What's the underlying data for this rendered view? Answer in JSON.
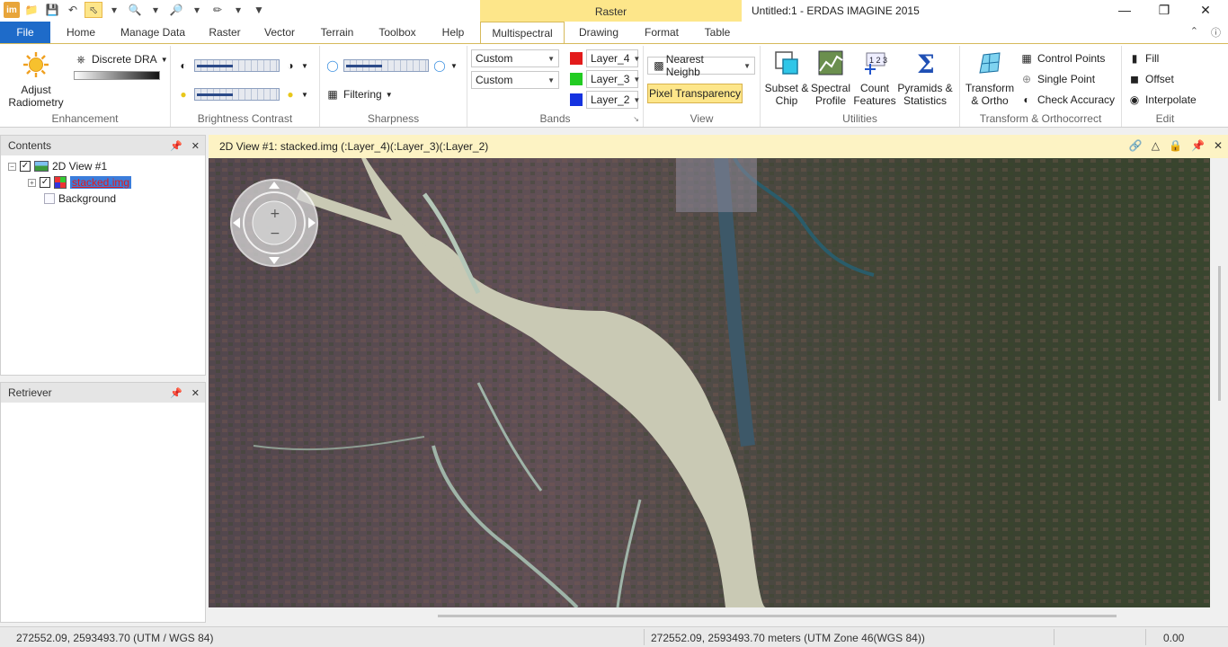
{
  "app": {
    "window_title": "Untitled:1 - ERDAS IMAGINE 2015",
    "context_tab_group": "Raster"
  },
  "tabs": {
    "file": "File",
    "home": "Home",
    "manage_data": "Manage Data",
    "raster": "Raster",
    "vector": "Vector",
    "terrain": "Terrain",
    "toolbox": "Toolbox",
    "help": "Help",
    "multispectral": "Multispectral",
    "drawing": "Drawing",
    "format": "Format",
    "table": "Table"
  },
  "ribbon": {
    "enhancement": {
      "adjust_radiometry": "Adjust Radiometry",
      "discrete_dra": "Discrete DRA",
      "label": "Enhancement"
    },
    "brightness_contrast": {
      "label": "Brightness Contrast"
    },
    "sharpness": {
      "filtering": "Filtering",
      "label": "Sharpness"
    },
    "bands": {
      "combo_top": "Custom",
      "combo_bottom": "Custom",
      "red_layer": "Layer_4",
      "green_layer": "Layer_3",
      "blue_layer": "Layer_2",
      "red_color": "#e31b1b",
      "green_color": "#22cc22",
      "blue_color": "#1533e0",
      "label": "Bands"
    },
    "view": {
      "resample": "Nearest Neighb",
      "pixel_transparency": "Pixel Transparency",
      "label": "View"
    },
    "utilities": {
      "subset_chip": "Subset & Chip",
      "spectral_profile": "Spectral Profile",
      "count_features": "Count Features",
      "pyramids_statistics": "Pyramids & Statistics",
      "label": "Utilities"
    },
    "transform": {
      "transform_ortho": "Transform & Ortho",
      "control_points": "Control Points",
      "single_point": "Single Point",
      "check_accuracy": "Check Accuracy",
      "label": "Transform & Orthocorrect"
    },
    "edit": {
      "fill": "Fill",
      "offset": "Offset",
      "interpolate": "Interpolate",
      "label": "Edit"
    }
  },
  "contents_panel": {
    "title": "Contents",
    "view_node": "2D View #1",
    "layer_node": "stacked.img",
    "background_node": "Background"
  },
  "retriever_panel": {
    "title": "Retriever"
  },
  "viewer": {
    "title": "2D View #1: stacked.img (:Layer_4)(:Layer_3)(:Layer_2)"
  },
  "status_bar": {
    "coords_left": "272552.09, 2593493.70  (UTM / WGS 84)",
    "coords_right": "272552.09, 2593493.70 meters (UTM Zone 46(WGS 84))",
    "value": "0.00"
  }
}
